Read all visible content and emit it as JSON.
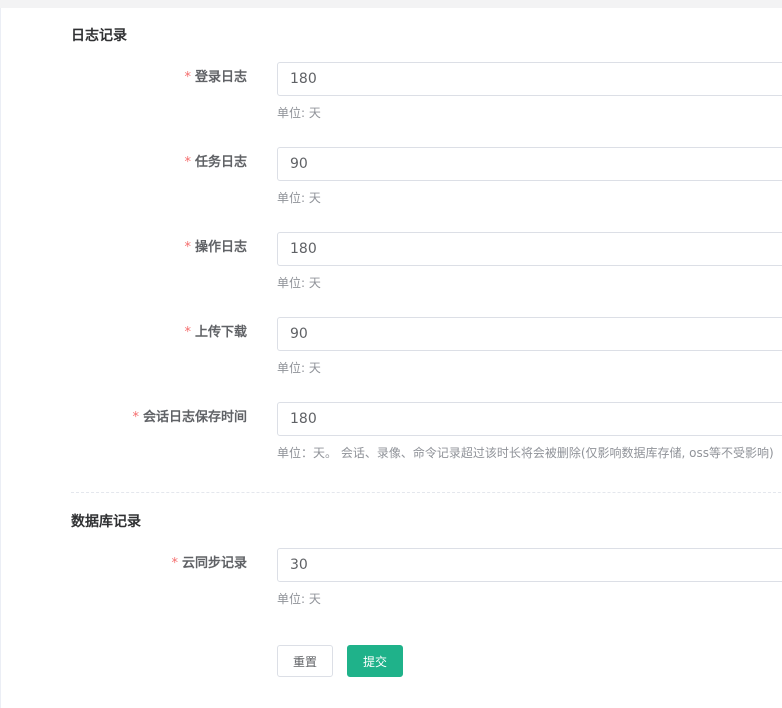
{
  "sections": {
    "log": {
      "title": "日志记录"
    },
    "db": {
      "title": "数据库记录"
    }
  },
  "required_mark": "*",
  "fields": {
    "login_log": {
      "label": "登录日志",
      "value": "180",
      "hint": "单位: 天"
    },
    "task_log": {
      "label": "任务日志",
      "value": "90",
      "hint": "单位: 天"
    },
    "operation_log": {
      "label": "操作日志",
      "value": "180",
      "hint": "单位: 天"
    },
    "upload_download": {
      "label": "上传下载",
      "value": "90",
      "hint": "单位: 天"
    },
    "session_log_retention": {
      "label": "会话日志保存时间",
      "value": "180",
      "hint": "单位：天。 会话、录像、命令记录超过该时长将会被删除(仅影响数据库存储, oss等不受影响)"
    },
    "cloud_sync_record": {
      "label": "云同步记录",
      "value": "30",
      "hint": "单位: 天"
    }
  },
  "buttons": {
    "reset": "重置",
    "submit": "提交"
  },
  "colors": {
    "primary": "#1fb28a",
    "required": "#f56c6c"
  }
}
